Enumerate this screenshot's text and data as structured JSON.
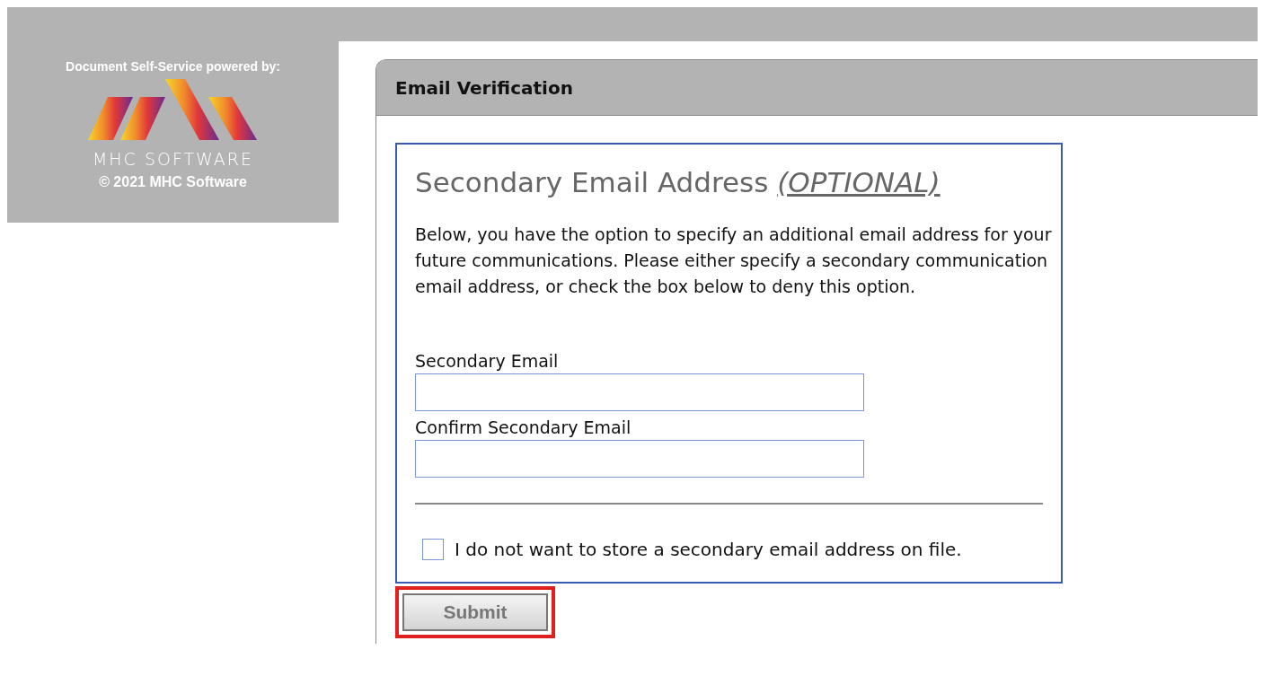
{
  "sidebar": {
    "powered_by": "Document Self-Service powered by:",
    "brand": "MHC SOFTWARE",
    "copyright": "© 2021  MHC Software"
  },
  "panel": {
    "title": "Email Verification"
  },
  "form": {
    "heading": "Secondary Email Address",
    "heading_note": "(OPTIONAL)",
    "description": "Below, you have the option to specify an additional email address for your future communications. Please either specify a secondary communication email address, or check the box below to deny this option.",
    "fields": [
      {
        "label": "Secondary Email"
      },
      {
        "label": "Confirm Secondary Email"
      }
    ],
    "opt_out": {
      "label": "I do not want to store a secondary email address on file.",
      "checked": false
    },
    "submit": {
      "label": "Submit",
      "highlighted": true
    }
  }
}
